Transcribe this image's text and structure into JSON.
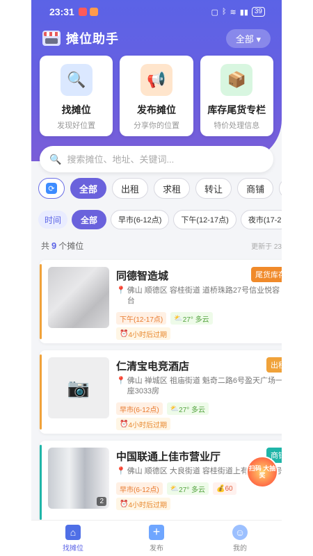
{
  "status": {
    "time": "23:31",
    "battery": "39"
  },
  "header": {
    "title": "摊位助手",
    "filter": "全部"
  },
  "actions": [
    {
      "title": "找摊位",
      "subtitle": "发现好位置",
      "icon": "magnifier-icon"
    },
    {
      "title": "发布摊位",
      "subtitle": "分享你的位置",
      "icon": "megaphone-icon"
    },
    {
      "title": "库存尾货专栏",
      "subtitle": "特价处理信息",
      "icon": "box-icon"
    }
  ],
  "search": {
    "placeholder": "搜索摊位、地址、关键词..."
  },
  "types": [
    "全部",
    "出租",
    "求租",
    "转让",
    "商铺",
    "厂"
  ],
  "time_filter": {
    "label": "时间",
    "options": [
      "全部",
      "早市(6-12点)",
      "下午(12-17点)",
      "夜市(17-2"
    ]
  },
  "summary": {
    "prefix": "共",
    "count": "9",
    "suffix": "个摊位",
    "updated": "更新于 23"
  },
  "listings": [
    {
      "name": "同德智造城",
      "tag": "尾货库存",
      "tag_color": "#f08a2a",
      "bar_color": "#f0a23a",
      "address": "佛山 顺德区 容桂街道 道桥珠路27号信业悦容台",
      "time": "下午(12-17点)",
      "weather": "27° 多云",
      "expire": "4小时后过期"
    },
    {
      "name": "仁清宝电竞酒店",
      "tag": "出租",
      "tag_color": "#f0a23a",
      "bar_color": "#f0a23a",
      "address": "佛山 禅城区 祖庙街道 魁奇二路6号盈天广场一座3033房",
      "time": "早市(6-12点)",
      "weather": "27° 多云",
      "expire": "4小时后过期"
    },
    {
      "name": "中国联通上佳市营业厅",
      "tag": "商铺",
      "tag_color": "#1fb5a8",
      "bar_color": "#1fb5a8",
      "address": "佛山 顺德区 大良街道 容桂街道上有西路3-4号",
      "time": "早市(6-12点)",
      "weather": "27° 多云",
      "price": "60",
      "expire": "4小时后过期",
      "photo_count": "2"
    }
  ],
  "promo": {
    "text": "扫码 大抽奖"
  },
  "tabs": [
    {
      "label": "找摊位",
      "icon": "home-icon"
    },
    {
      "label": "发布",
      "icon": "plus-icon"
    },
    {
      "label": "我的",
      "icon": "user-icon"
    }
  ]
}
